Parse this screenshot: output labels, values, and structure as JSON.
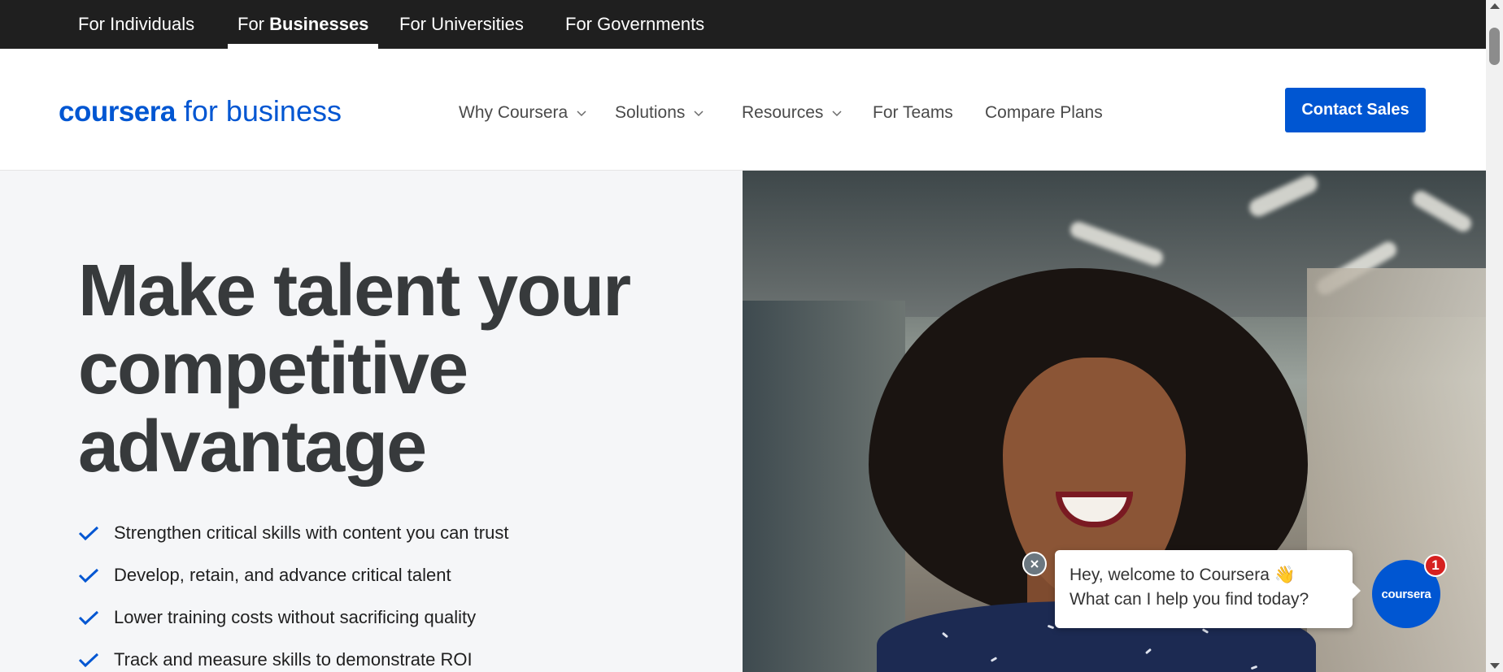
{
  "audience_nav": {
    "items": [
      {
        "prefix": "For",
        "label": "Individuals"
      },
      {
        "prefix": "For",
        "label": "Businesses"
      },
      {
        "prefix": "For",
        "label": "Universities"
      },
      {
        "prefix": "For",
        "label": "Governments"
      }
    ],
    "active": "Businesses"
  },
  "header": {
    "logo_brand": "coursera",
    "logo_suffix": "for business",
    "nav": [
      {
        "label": "Why Coursera",
        "has_dropdown": true
      },
      {
        "label": "Solutions",
        "has_dropdown": true
      },
      {
        "label": "Resources",
        "has_dropdown": true
      },
      {
        "label": "For Teams",
        "has_dropdown": false
      },
      {
        "label": "Compare Plans",
        "has_dropdown": false
      }
    ],
    "cta_label": "Contact Sales"
  },
  "hero": {
    "title": "Make talent your competitive advantage",
    "bullets": [
      "Strengthen critical skills with content you can trust",
      "Develop, retain, and advance critical talent",
      "Lower training costs without sacrificing quality",
      "Track and measure skills to demonstrate ROI"
    ]
  },
  "chat": {
    "line1": "Hey, welcome to Coursera 👋",
    "line2": "What can I help you find today?",
    "launcher_label": "coursera",
    "badge_count": "1"
  },
  "colors": {
    "brand_blue": "#0056d2",
    "topbar_bg": "#1f1f1f",
    "hero_bg": "#f5f6f8",
    "badge_red": "#d62020"
  }
}
